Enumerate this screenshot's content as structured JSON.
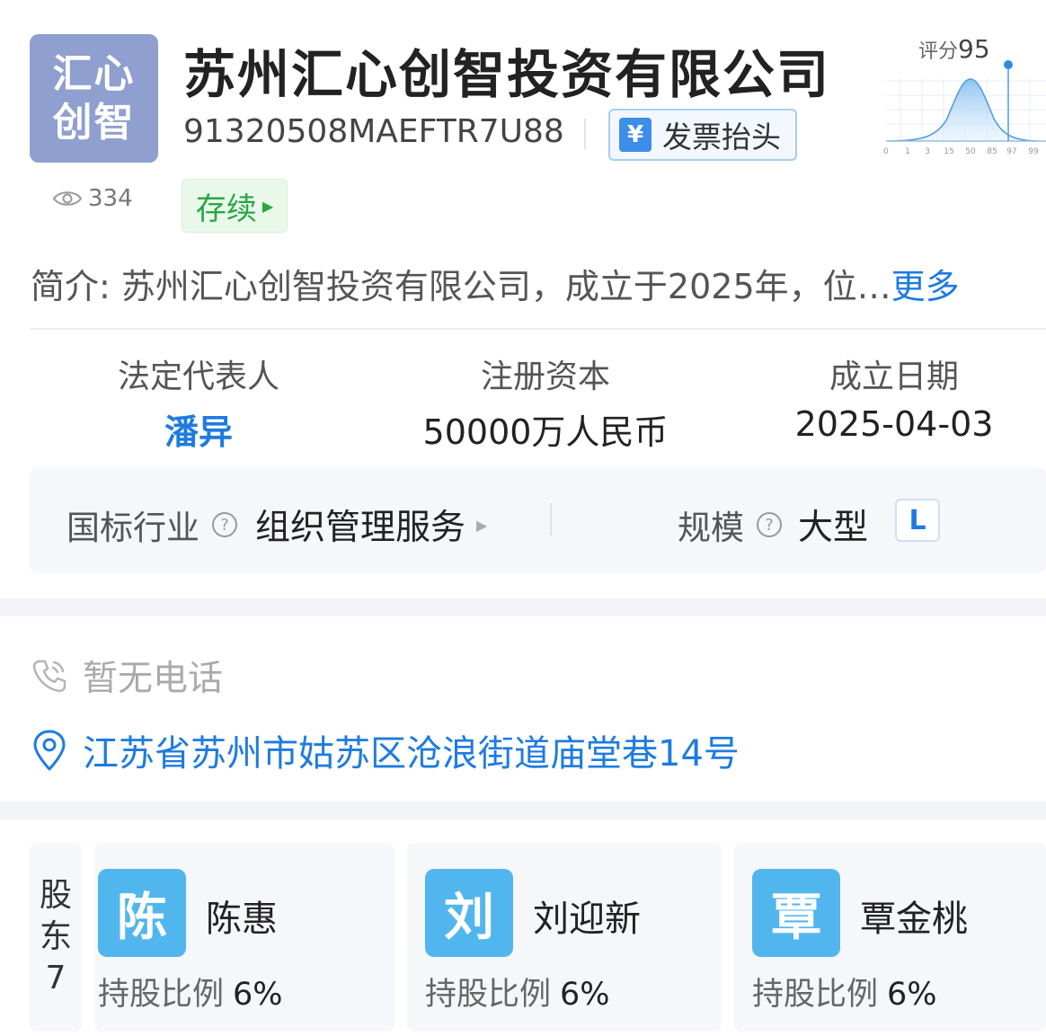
{
  "company": {
    "logo_line1": "汇心",
    "logo_line2": "创智",
    "name": "苏州汇心创智投资有限公司",
    "credit_code": "91320508MAEFTR7U88",
    "invoice_label": "发票抬头",
    "invoice_icon": "yen-receipt-icon",
    "views": "334",
    "status": "存续"
  },
  "score": {
    "label": "评分",
    "value": "95",
    "axis_ticks": [
      "0",
      "1",
      "3",
      "15",
      "50",
      "85",
      "97",
      "99"
    ]
  },
  "intro": {
    "label": "简介:",
    "text": "苏州汇心创智投资有限公司，成立于2025年，位…",
    "more": "更多"
  },
  "key_info": {
    "legal_rep_label": "法定代表人",
    "legal_rep_value": "潘异",
    "capital_label": "注册资本",
    "capital_value": "50000万人民币",
    "date_label": "成立日期",
    "date_value": "2025-04-03"
  },
  "industry": {
    "label": "国标行业",
    "value": "组织管理服务",
    "scale_label": "规模",
    "scale_value": "大型",
    "scale_badge": "L",
    "help_icon": "?"
  },
  "contact": {
    "phone": "暂无电话",
    "address": "江苏省苏州市姑苏区沧浪街道庙堂巷14号"
  },
  "shareholders": {
    "label_line1": "股",
    "label_line2": "东",
    "count": "7",
    "ratio_label": "持股比例",
    "items": [
      {
        "avatar": "陈",
        "name": "陈惠",
        "ratio": "6%"
      },
      {
        "avatar": "刘",
        "name": "刘迎新",
        "ratio": "6%"
      },
      {
        "avatar": "覃",
        "name": "覃金桃",
        "ratio": "6%"
      }
    ]
  },
  "colors": {
    "accent": "#1e7be0",
    "logo_bg": "#8f9fcf",
    "status_green": "#28a745",
    "avatar_bg": "#52b6ee"
  }
}
